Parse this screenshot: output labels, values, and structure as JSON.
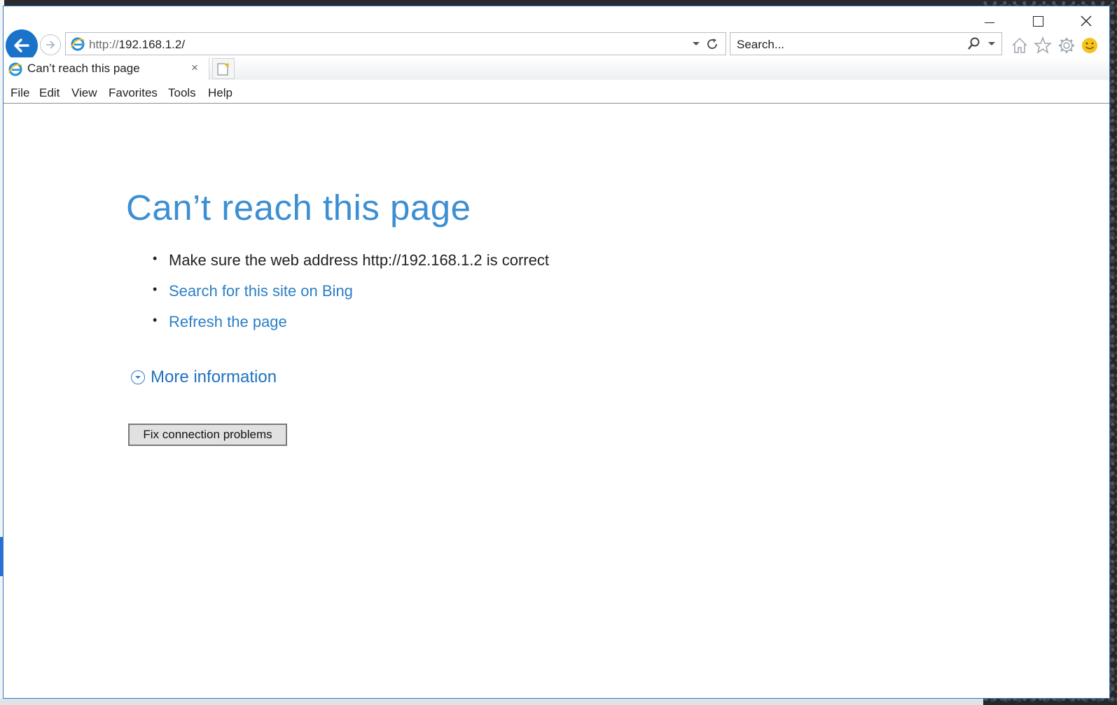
{
  "browser": {
    "window_controls": {
      "minimize": "minimize",
      "maximize": "maximize",
      "close": "close"
    },
    "address_bar": {
      "url_protocol": "http://",
      "url_host": "192.168.1.2/"
    },
    "search_box": {
      "placeholder": "Search..."
    },
    "tab": {
      "title": "Can’t reach this page",
      "close_glyph": "×"
    },
    "menu": [
      "File",
      "Edit",
      "View",
      "Favorites",
      "Tools",
      "Help"
    ],
    "icons": [
      "back-arrow-icon",
      "forward-arrow-icon",
      "ie-logo-icon",
      "dropdown-icon",
      "refresh-icon",
      "search-icon",
      "home-icon",
      "favorites-star-icon",
      "gear-icon",
      "smiley-feedback-icon",
      "new-tab-icon"
    ],
    "accent_color": "#1a73c9"
  },
  "page": {
    "headline": "Can’t reach this page",
    "bullets": {
      "check_address": "Make sure the web address http://192.168.1.2 is correct",
      "search_bing": "Search for this site on Bing",
      "refresh": "Refresh the page"
    },
    "more_info": "More information",
    "fix_button": "Fix connection problems",
    "link_color": "#2c7fc6",
    "headline_color": "#3d8fd3"
  }
}
